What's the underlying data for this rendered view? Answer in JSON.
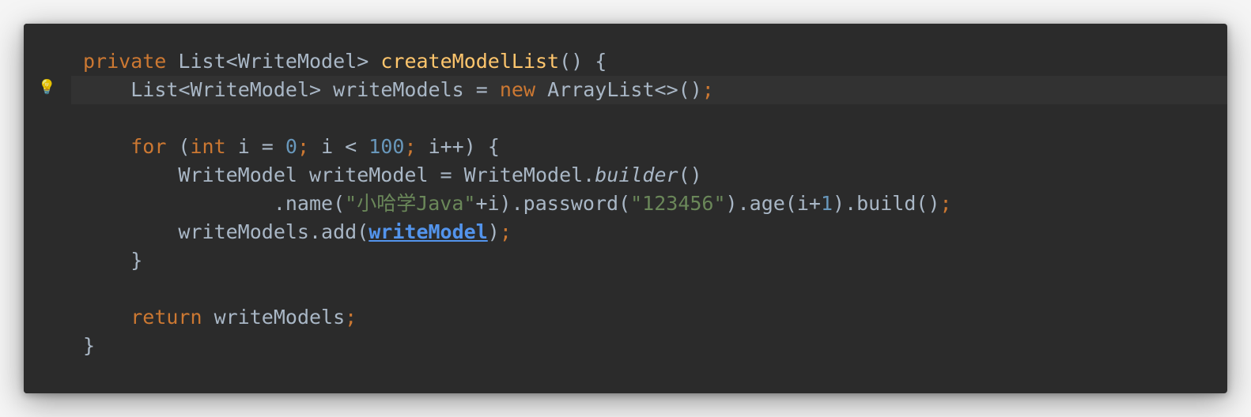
{
  "gutter": {
    "lightbulb_icon": "💡"
  },
  "code": {
    "line1": {
      "kw_private": "private",
      "type_list": "List",
      "lt1": "<",
      "type_wm": "WriteModel",
      "gt1": ">",
      "sp1": " ",
      "method_name": "createModelList",
      "parens_brace": "() {"
    },
    "line2": {
      "indent": "    ",
      "type_list": "List",
      "lt": "<",
      "type_wm": "WriteModel",
      "gt": ">",
      "var_decl": " writeModels = ",
      "kw_new": "new",
      "sp": " ",
      "type_al": "ArrayList",
      "diamond": "<>()",
      "semi": ";"
    },
    "line3": {
      "blank": ""
    },
    "line4": {
      "indent": "    ",
      "kw_for": "for",
      "sp1": " (",
      "kw_int": "int",
      "var_i": " i = ",
      "num_0": "0",
      "semi1": ";",
      "cond": " i < ",
      "num_100": "100",
      "semi2": ";",
      "incr": " i++) {"
    },
    "line5": {
      "indent": "        ",
      "type_wm": "WriteModel writeModel = WriteModel.",
      "builder": "builder",
      "parens": "()"
    },
    "line6": {
      "indent": "                ",
      "dot_name": ".name(",
      "str1": "\"小哈学Java\"",
      "plus_i": "+i).password(",
      "str2": "\"123456\"",
      "rest1": ").age(i+",
      "num_1": "1",
      "rest2": ").build()",
      "semi": ";"
    },
    "line7": {
      "indent": "        ",
      "call": "writeModels.add(",
      "ref": "writeModel",
      "close": ")",
      "semi": ";"
    },
    "line8": {
      "indent": "    ",
      "brace": "}"
    },
    "line9": {
      "blank": ""
    },
    "line10": {
      "indent": "    ",
      "kw_return": "return",
      "var": " writeModels",
      "semi": ";"
    },
    "line11": {
      "brace": "}"
    }
  }
}
